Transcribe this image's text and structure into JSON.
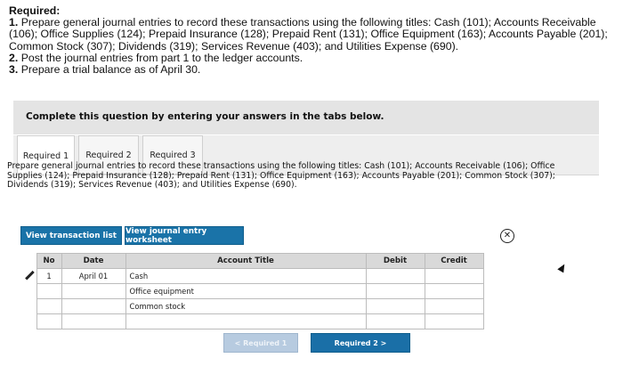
{
  "requirements": {
    "title": "Required:",
    "item1_num": "1.",
    "item1": "Prepare general journal entries to record these transactions using the following titles: Cash (101); Accounts Receivable (106); Office Supplies (124); Prepaid Insurance (128); Prepaid Rent (131); Office Equipment (163); Accounts Payable (201); Common Stock (307); Dividends (319); Services Revenue (403); and Utilities Expense (690).",
    "item2_num": "2.",
    "item2": "Post the journal entries from part 1 to the ledger accounts.",
    "item3_num": "3.",
    "item3": "Prepare a trial balance as of April 30."
  },
  "instruction": "Complete this question by entering your answers in the tabs below.",
  "tabs": [
    {
      "label": "Required 1",
      "active": true
    },
    {
      "label": "Required 2",
      "active": false
    },
    {
      "label": "Required 3",
      "active": false
    }
  ],
  "panel_text": "Prepare general journal entries to record these transactions using the following titles: Cash (101); Accounts Receivable (106); Office Supplies (124); Prepaid Insurance (128); Prepaid Rent (131); Office Equipment (163); Accounts Payable (201); Common Stock (307); Dividends (319); Services Revenue (403); and Utilities Expense (690).",
  "buttons": {
    "transaction_list": "View transaction list",
    "journal_worksheet": "View journal entry worksheet"
  },
  "close_icon": "close-circle-icon",
  "table": {
    "headers": [
      "No",
      "Date",
      "Account Title",
      "Debit",
      "Credit"
    ],
    "rows": [
      {
        "no": "1",
        "date": "April 01",
        "account": "Cash",
        "debit": "",
        "credit": ""
      },
      {
        "no": "",
        "date": "",
        "account": "Office equipment",
        "debit": "",
        "credit": ""
      },
      {
        "no": "",
        "date": "",
        "account": "Common stock",
        "debit": "",
        "credit": ""
      },
      {
        "no": "",
        "date": "",
        "account": "",
        "debit": "",
        "credit": ""
      }
    ]
  },
  "nav": {
    "prev_label": "< Required 1",
    "next_label": "Required 2  >"
  },
  "colors": {
    "teal_button": "#1a73a8",
    "next_button": "#1a6fa7",
    "prev_button_disabled": "#b7cbe0",
    "instruction_bg": "#e4e4e4",
    "header_bg": "#d9d9d9"
  }
}
